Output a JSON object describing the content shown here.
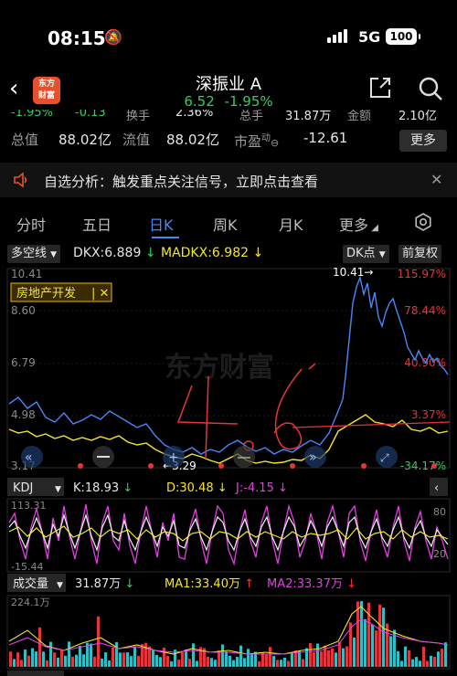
{
  "status": {
    "time": "08:15",
    "network": "5G",
    "battery": "100"
  },
  "header": {
    "name": "深振业 A",
    "price": "6.52",
    "change_pct": "-1.95%",
    "logo_text": "东方财富"
  },
  "partial_row": [
    "-1.95%",
    "-0.13",
    "换手",
    "2.36%",
    "总手",
    "31.87万",
    "金额",
    "2.10亿"
  ],
  "info": {
    "total_value_label": "总值",
    "total_value": "88.02亿",
    "float_label": "流值",
    "float_value": "88.02亿",
    "pe_label": "市盈",
    "pe_sup": "动",
    "pe_value": "-12.61",
    "more": "更多"
  },
  "analysis": {
    "text": "自选分析：触发重点关注信号，立即点击查看"
  },
  "tabs": [
    "分时",
    "五日",
    "日K",
    "周K",
    "月K",
    "更多"
  ],
  "active_tab": "日K",
  "indicator": {
    "selector": "多空线",
    "dkx": "DKX:6.889",
    "madkx": "MADKX:6.982",
    "dk_point": "DK点",
    "adjust": "前复权"
  },
  "main_chart": {
    "y_labels": [
      "10.41",
      "8.60",
      "6.79",
      "4.98",
      "3.17"
    ],
    "right_labels": [
      "115.97%",
      "78.44%",
      "40.90%",
      "3.37%",
      "-34.17%"
    ],
    "high_marker": "10.41",
    "low_marker": "3.29",
    "sector_tag": "房地产开发",
    "watermark": "东方财富",
    "handwriting": "4.6"
  },
  "kdj": {
    "selector": "KDJ",
    "k": "K:18.93",
    "d": "D:30.48",
    "j": "J:-4.15",
    "y_top": "113.31",
    "y_bottom": "-15.44",
    "right_top": "80",
    "right_bottom": "20"
  },
  "volume": {
    "selector": "成交量",
    "vol": "31.87万",
    "ma1": "MA1:33.40万",
    "ma2": "MA2:33.37万",
    "y_top": "224.1万"
  },
  "colors": {
    "up": "#e8333a",
    "down": "#2ed05c",
    "blue": "#4a86f5",
    "yellow": "#f5e629",
    "magenta": "#e040e0"
  }
}
